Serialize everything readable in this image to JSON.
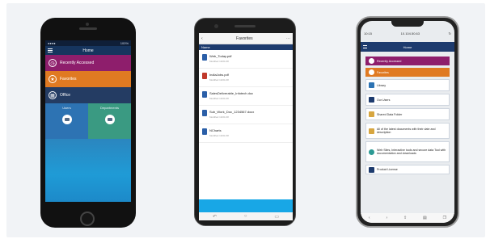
{
  "phones": [
    {
      "status": {
        "left": "●●●●",
        "right": "100%"
      },
      "title": "Home",
      "menu": [
        {
          "label": "Recently Accessed",
          "icon": "clock-icon"
        },
        {
          "label": "Favorites",
          "icon": "star-icon"
        },
        {
          "label": "Office",
          "icon": "building-icon"
        }
      ],
      "tiles": [
        {
          "label": "Users",
          "icon": "folder-icon"
        },
        {
          "label": "Departments",
          "icon": "folder-icon"
        }
      ]
    },
    {
      "title": "Favorites",
      "subtitle": "Name",
      "files": [
        {
          "name": "Web_Today.pdf",
          "meta": "Modified 10/21/18"
        },
        {
          "name": "IndiaJobs.pdf",
          "meta": "Modified 10/21/18"
        },
        {
          "name": "SalesDeliverable_Infotech.doc",
          "meta": "Modified 10/21/18"
        },
        {
          "name": "Sub_Work_Doc_1234567.docx",
          "meta": "Modified 10/21/18"
        },
        {
          "name": "NCharts",
          "meta": "Modified 10/21/18"
        }
      ]
    },
    {
      "time": "10:15",
      "url": "10.104.50.63",
      "title": "Home",
      "menu": [
        {
          "label": "Recently Accessed",
          "style": "recent"
        },
        {
          "label": "Favorites",
          "style": "fav"
        },
        {
          "label": "Library",
          "style": ""
        },
        {
          "label": "Our Users",
          "style": ""
        },
        {
          "label": "Shared Data Folder",
          "style": ""
        },
        {
          "label": "All of the latest documents with their date and description",
          "style": ""
        },
        {
          "label": "Web Sites, Interactive tools and secure data Tool with documentation and downloads",
          "style": ""
        },
        {
          "label": "Product License",
          "style": ""
        }
      ]
    }
  ]
}
